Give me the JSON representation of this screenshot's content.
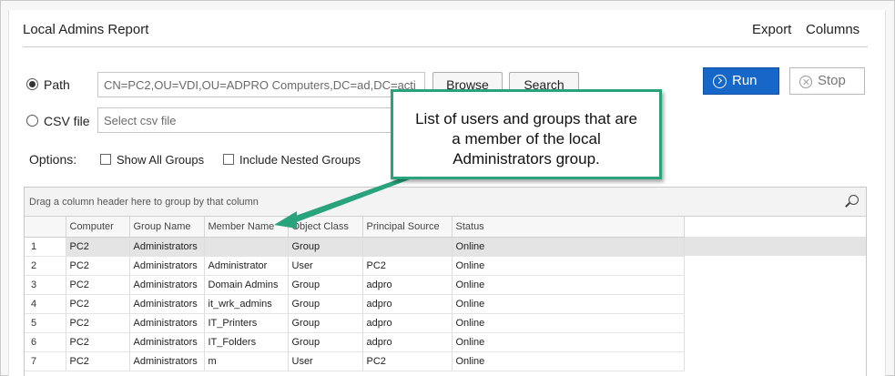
{
  "report": {
    "title": "Local Admins Report",
    "export_label": "Export",
    "columns_label": "Columns"
  },
  "source": {
    "path_label": "Path",
    "path_value": "CN=PC2,OU=VDI,OU=ADPRO Computers,DC=ad,DC=acti",
    "path_selected": true,
    "csv_label": "CSV file",
    "csv_placeholder": "Select csv file",
    "browse_label": "Browse",
    "search_label": "Search"
  },
  "actions": {
    "run_label": "Run",
    "stop_label": "Stop"
  },
  "options": {
    "label": "Options:",
    "show_all_groups_label": "Show All Groups",
    "show_all_groups_checked": false,
    "include_nested_groups_label": "Include Nested Groups",
    "include_nested_groups_checked": false
  },
  "grid": {
    "group_panel_text": "Drag a column header here to group by that column",
    "columns": [
      "Computer",
      "Group Name",
      "Member Name",
      "Object Class",
      "Principal Source",
      "Status"
    ],
    "rows": [
      {
        "n": "1",
        "cells": [
          "PC2",
          "Administrators",
          "",
          "Group",
          "",
          "Online"
        ]
      },
      {
        "n": "2",
        "cells": [
          "PC2",
          "Administrators",
          "Administrator",
          "User",
          "PC2",
          "Online"
        ]
      },
      {
        "n": "3",
        "cells": [
          "PC2",
          "Administrators",
          "Domain Admins",
          "Group",
          "adpro",
          "Online"
        ]
      },
      {
        "n": "4",
        "cells": [
          "PC2",
          "Administrators",
          "it_wrk_admins",
          "Group",
          "adpro",
          "Online"
        ]
      },
      {
        "n": "5",
        "cells": [
          "PC2",
          "Administrators",
          "IT_Printers",
          "Group",
          "adpro",
          "Online"
        ]
      },
      {
        "n": "6",
        "cells": [
          "PC2",
          "Administrators",
          "IT_Folders",
          "Group",
          "adpro",
          "Online"
        ]
      },
      {
        "n": "7",
        "cells": [
          "PC2",
          "Administrators",
          "m",
          "User",
          "PC2",
          "Online"
        ]
      }
    ]
  },
  "callout": {
    "text_line1": "List of users and groups that are",
    "text_line2": "a member of the local",
    "text_line3": "Administrators group.",
    "border_color": "#29a37c"
  },
  "colors": {
    "run_button": "#1767c9",
    "callout_accent": "#29a37c"
  }
}
